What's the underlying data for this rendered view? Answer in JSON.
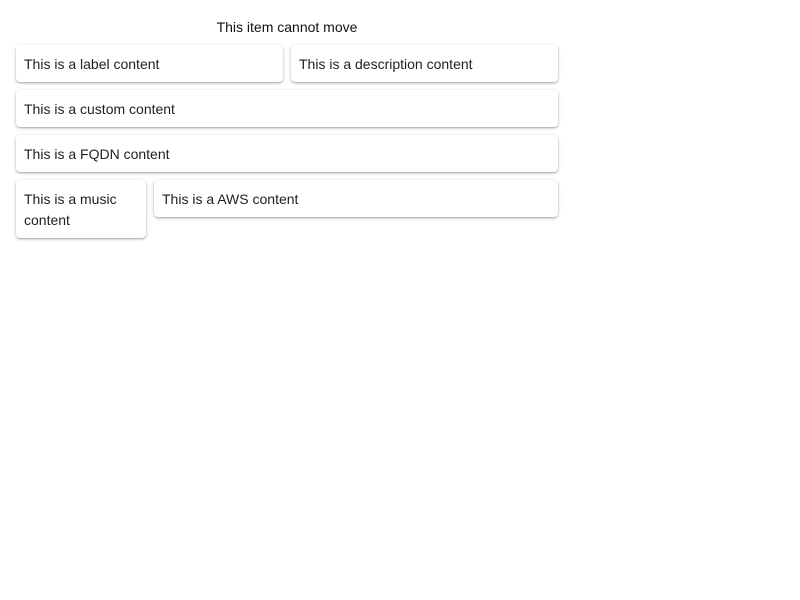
{
  "header": {
    "note": "This item cannot move"
  },
  "cards": {
    "label": "This is a label content",
    "description": "This is a description content",
    "custom": "This is a custom content",
    "fqdn": "This is a FQDN content",
    "music": "This is a music content",
    "aws": "This is a AWS content"
  }
}
